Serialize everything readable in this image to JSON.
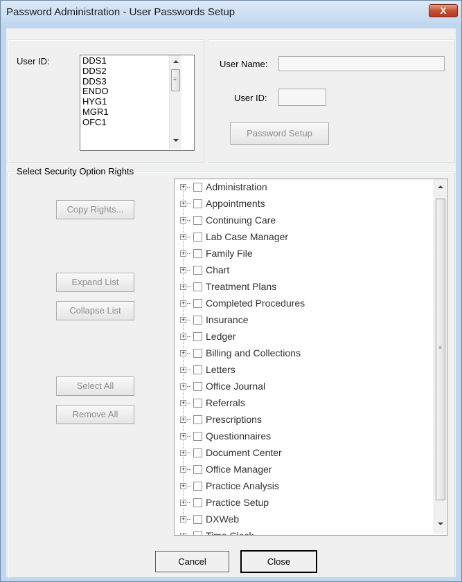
{
  "window": {
    "title": "Password Administration - User Passwords Setup",
    "close_glyph": "X"
  },
  "user_list": {
    "label": "User ID:",
    "items": [
      "DDS1",
      "DDS2",
      "DDS3",
      "ENDO",
      "HYG1",
      "MGR1",
      "OFC1"
    ]
  },
  "user_details": {
    "name_label": "User Name:",
    "name_value": "",
    "id_label": "User ID:",
    "id_value": "",
    "password_setup": "Password Setup"
  },
  "security": {
    "group_label": "Select Security Option Rights",
    "copy_rights": "Copy Rights...",
    "expand_list": "Expand List",
    "collapse_list": "Collapse List",
    "select_all": "Select All",
    "remove_all": "Remove All",
    "expander_glyph": "+",
    "tree_items": [
      "Administration",
      "Appointments",
      "Continuing Care",
      "Lab Case Manager",
      "Family File",
      "Chart",
      "Treatment Plans",
      "Completed Procedures",
      "Insurance",
      "Ledger",
      "Billing and Collections",
      "Letters",
      "Office Journal",
      "Referrals",
      "Prescriptions",
      "Questionnaires",
      "Document Center",
      "Office Manager",
      "Practice Analysis",
      "Practice Setup",
      "DXWeb",
      "Time Clock"
    ]
  },
  "footer": {
    "cancel": "Cancel",
    "close": "Close"
  },
  "scroll_grip": "≡",
  "colors": {
    "title_close": "#c75034",
    "disabled_text": "#8d8d8d",
    "frame": "#bfd6ee"
  }
}
